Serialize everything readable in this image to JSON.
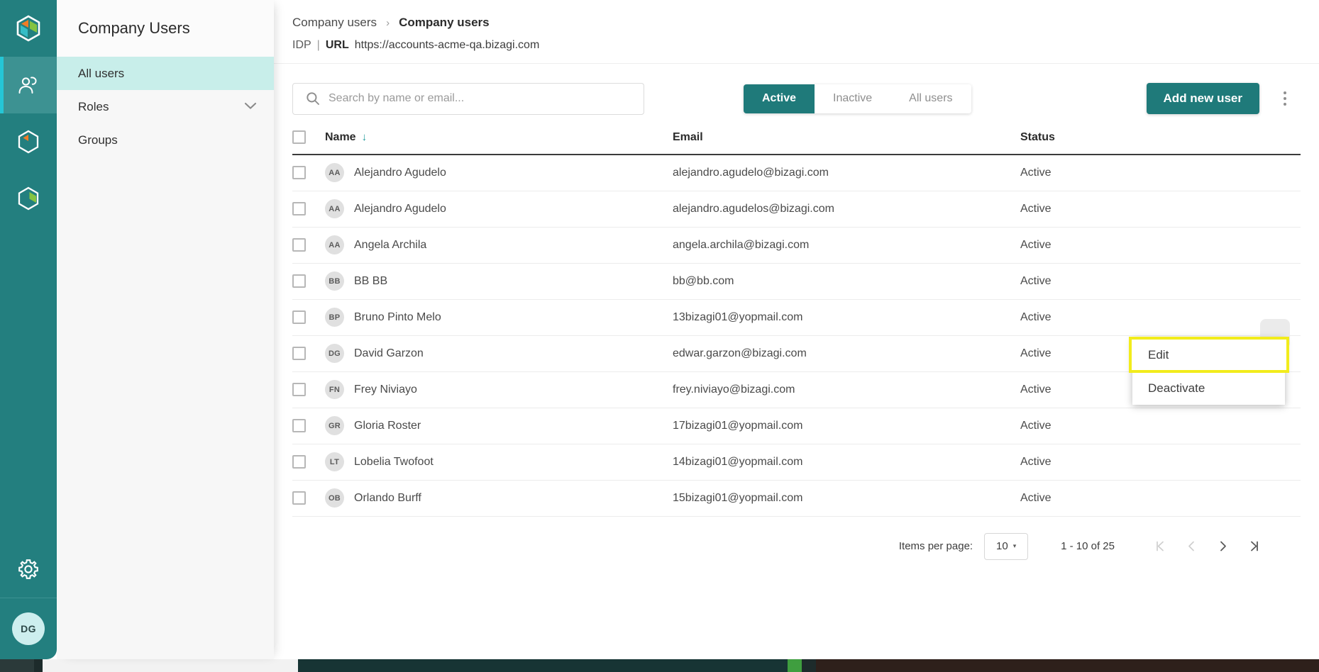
{
  "rail": {
    "logo_icon": "bizagi-hexagon-logo",
    "items": [
      {
        "icon": "users-icon",
        "name": "company-users",
        "active": true
      },
      {
        "icon": "hexagon-pie-icon",
        "name": "modeler",
        "active": false
      },
      {
        "icon": "hexagon-segment-icon",
        "name": "automation",
        "active": false
      }
    ],
    "gear_icon": "gear-icon",
    "avatar_initials": "DG"
  },
  "sidebar": {
    "title": "Company Users",
    "items": [
      {
        "label": "All users",
        "active": true,
        "chevron": ""
      },
      {
        "label": "Roles",
        "active": false,
        "chevron": "⌄"
      },
      {
        "label": "Groups",
        "active": false,
        "chevron": ""
      }
    ]
  },
  "header": {
    "breadcrumb_parent": "Company users",
    "breadcrumb_sep": "›",
    "breadcrumb_current": "Company users",
    "idp_label": "IDP",
    "pipe": "|",
    "url_label": "URL",
    "url_value": "https://accounts-acme-qa.bizagi.com"
  },
  "toolbar": {
    "search_placeholder": "Search by name or email...",
    "search_value": "",
    "search_icon": "search-icon",
    "filters": [
      {
        "label": "Active",
        "active": true
      },
      {
        "label": "Inactive",
        "active": false
      },
      {
        "label": "All users",
        "active": false
      }
    ],
    "add_user_label": "Add new user",
    "more_icon": "kebab-menu-icon"
  },
  "table": {
    "columns": [
      "Name",
      "Email",
      "Status"
    ],
    "sort_column": "Name",
    "sort_icon": "↓",
    "select_all_checked": false,
    "rows": [
      {
        "initials": "AA",
        "name": "Alejandro Agudelo",
        "email": "alejandro.agudelo@bizagi.com",
        "status": "Active"
      },
      {
        "initials": "AA",
        "name": "Alejandro Agudelo",
        "email": "alejandro.agudelos@bizagi.com",
        "status": "Active"
      },
      {
        "initials": "AA",
        "name": "Angela Archila",
        "email": "angela.archila@bizagi.com",
        "status": "Active"
      },
      {
        "initials": "BB",
        "name": "BB BB",
        "email": "bb@bb.com",
        "status": "Active"
      },
      {
        "initials": "BP",
        "name": "Bruno Pinto Melo",
        "email": "13bizagi01@yopmail.com",
        "status": "Active"
      },
      {
        "initials": "DG",
        "name": "David Garzon",
        "email": "edwar.garzon@bizagi.com",
        "status": "Active"
      },
      {
        "initials": "FN",
        "name": "Frey Niviayo",
        "email": "frey.niviayo@bizagi.com",
        "status": "Active"
      },
      {
        "initials": "GR",
        "name": "Gloria Roster",
        "email": "17bizagi01@yopmail.com",
        "status": "Active"
      },
      {
        "initials": "LT",
        "name": "Lobelia Twofoot",
        "email": "14bizagi01@yopmail.com",
        "status": "Active"
      },
      {
        "initials": "OB",
        "name": "Orlando Burff",
        "email": "15bizagi01@yopmail.com",
        "status": "Active"
      }
    ]
  },
  "context_menu": {
    "items": [
      {
        "label": "Edit",
        "highlighted": true
      },
      {
        "label": "Deactivate",
        "highlighted": false
      }
    ]
  },
  "pagination": {
    "items_per_page_label": "Items per page:",
    "items_per_page_value": "10",
    "caret": "▾",
    "range_text": "1 - 10 of 25",
    "first_icon": "⇤",
    "prev_icon": "‹",
    "next_icon": "›",
    "last_icon": "⇥"
  },
  "colors": {
    "brand_teal": "#1f7a7a",
    "rail_teal": "#237f7f",
    "rail_active": "#3d9292",
    "accent_cyan": "#25c6d6",
    "nav_active": "#c8eeea",
    "highlight_yellow": "#f2ec1c"
  }
}
